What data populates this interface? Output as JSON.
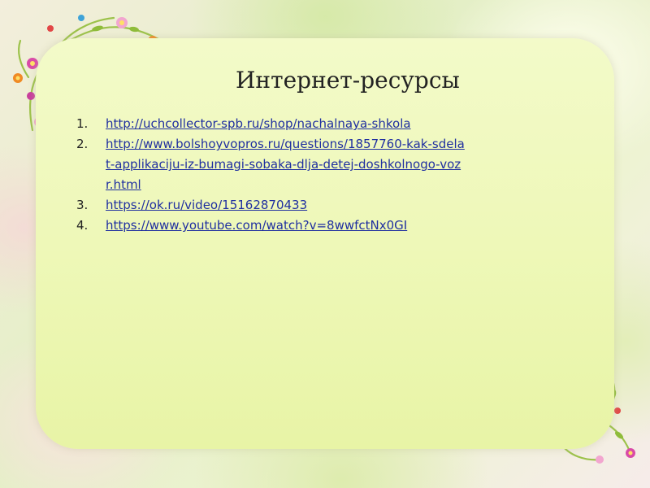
{
  "slide": {
    "title": "Интернет-ресурсы",
    "resources": [
      {
        "number": "1.",
        "url": "http://uchcollector-spb.ru/shop/nachalnaya-shkola"
      },
      {
        "number": "2.",
        "url": "http://www.bolshoyvopros.ru/questions/1857760-kak-sdelat-applikaciju-iz-bumagi-sobaka-dlja-detej-doshkolnogo-vozr.html"
      },
      {
        "number": "3.",
        "url": "https://ok.ru/video/15162870433"
      },
      {
        "number": "4.",
        "url": "https://www.youtube.com/watch?v=8wwfctNx0GI"
      }
    ]
  },
  "decor": {
    "corner_top_left": "floral-corner-icon",
    "corner_bottom_right": "floral-corner-icon"
  },
  "colors": {
    "panel": "#eef8b8",
    "link": "#1f2fa0",
    "title": "#222222"
  }
}
